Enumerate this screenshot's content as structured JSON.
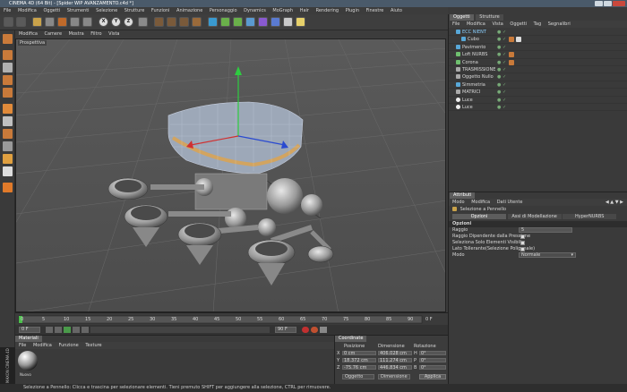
{
  "window": {
    "title": "CINEMA 4D (64 Bit) - [Spider WIP AVANZAMENTO.c4d *]"
  },
  "menubar": [
    "File",
    "Modifica",
    "Oggetti",
    "Strumenti",
    "Selezione",
    "Strutture",
    "Funzioni",
    "Animazione",
    "Personaggio",
    "Dynamics",
    "MoGraph",
    "Hair",
    "Rendering",
    "Plugin",
    "Finestre",
    "Aiuto"
  ],
  "toolbar": {
    "axis_x": "X",
    "axis_y": "Y",
    "axis_z": "Z"
  },
  "viewport": {
    "menu": [
      "Modifica",
      "Camere",
      "Mostra",
      "Filtro",
      "Vista"
    ],
    "label": "Prospettiva"
  },
  "timeline": {
    "ticks": [
      "0",
      "5",
      "10",
      "15",
      "20",
      "25",
      "30",
      "35",
      "40",
      "45",
      "50",
      "55",
      "60",
      "65",
      "70",
      "75",
      "80",
      "85",
      "90"
    ],
    "current_frame": "0 F",
    "end_frame": "90 F",
    "start_field": "0 F",
    "end_field": "90 F"
  },
  "materials": {
    "tab": "Materiali",
    "menu": [
      "File",
      "Modifica",
      "Funzione",
      "Texture"
    ],
    "swatch_label": "Nuovo"
  },
  "coordinates": {
    "tab": "Coordinate",
    "headers": [
      "Posizione",
      "Dimensione",
      "Rotazione"
    ],
    "rows": [
      {
        "axis": "X",
        "pos": "0 cm",
        "dim": "406.028 cm",
        "rot_axis": "H",
        "rot": "0°"
      },
      {
        "axis": "Y",
        "pos": "18.372 cm",
        "dim": "111.274 cm",
        "rot_axis": "P",
        "rot": "0°"
      },
      {
        "axis": "Z",
        "pos": "-75.76 cm",
        "dim": "446.834 cm",
        "rot_axis": "B",
        "rot": "0°"
      }
    ],
    "mode_object": "Oggetto",
    "mode_size": "Dimensione",
    "apply": "Applica"
  },
  "objects_panel": {
    "tabs": [
      "Oggetti",
      "Strutture"
    ],
    "menu": [
      "File",
      "Modifica",
      "Vista",
      "Oggetti",
      "Tag",
      "Segnalibri"
    ],
    "items": [
      {
        "name": "ECC NIENT",
        "color": "#58a8d8"
      },
      {
        "name": "Cubo",
        "color": "#58a8d8"
      },
      {
        "name": "Pavimento",
        "color": "#58a8d8"
      },
      {
        "name": "Loft NURBS",
        "color": "#6fc06f"
      },
      {
        "name": "Corona",
        "color": "#6fc06f"
      },
      {
        "name": "TRASMISSIONE",
        "color": "#aaaaaa"
      },
      {
        "name": "Oggetto Nullo",
        "color": "#aaaaaa"
      },
      {
        "name": "Simmetria",
        "color": "#58a8d8"
      },
      {
        "name": "MATRICI",
        "color": "#aaaaaa"
      },
      {
        "name": "Luce",
        "color": "#e8e8e8"
      },
      {
        "name": "Luce",
        "color": "#e8e8e8"
      }
    ]
  },
  "attributes_panel": {
    "tab": "Attributi",
    "menu": [
      "Modo",
      "Modifica",
      "Dati Utente"
    ],
    "tool_title": "Selezione a Pennello",
    "subtabs": [
      "Opzioni",
      "Assi di Modellazione",
      "HyperNURBS"
    ],
    "section": "Opzioni",
    "fields": [
      {
        "label": "Raggio",
        "value": "5"
      },
      {
        "label": "Raggio Dipendente dalla Pressione",
        "value": ""
      },
      {
        "label": "Seleziona Solo Elementi Visibili",
        "value": ""
      },
      {
        "label": "Lato Tollerante(Selezione Poligonale)",
        "value": ""
      },
      {
        "label": "Modo",
        "value": "Normale"
      }
    ]
  },
  "status": {
    "text": "Selezione a Pennello: Clicca e trascina per selezionare elementi. Tieni premuto SHIFT per aggiungere alla selezione, CTRL per rimuovere."
  },
  "badge": {
    "text": "MAXON CINEMA 4D"
  }
}
